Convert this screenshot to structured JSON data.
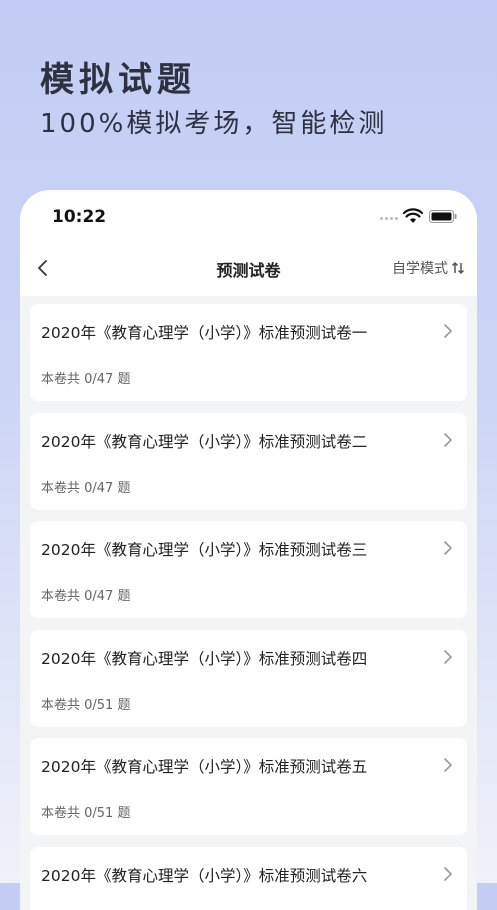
{
  "promo": {
    "title": "模拟试题",
    "subtitle": "100%模拟考场，智能检测"
  },
  "status_bar": {
    "time": "10:22"
  },
  "nav": {
    "title": "预测试卷",
    "mode_label": "自学模式"
  },
  "papers": [
    {
      "title": "2020年《教育心理学（小学）》标准预测试卷一",
      "meta": "本卷共 0/47 题"
    },
    {
      "title": "2020年《教育心理学（小学）》标准预测试卷二",
      "meta": "本卷共 0/47 题"
    },
    {
      "title": "2020年《教育心理学（小学）》标准预测试卷三",
      "meta": "本卷共 0/47 题"
    },
    {
      "title": "2020年《教育心理学（小学）》标准预测试卷四",
      "meta": "本卷共 0/51 题"
    },
    {
      "title": "2020年《教育心理学（小学）》标准预测试卷五",
      "meta": "本卷共 0/51 题"
    },
    {
      "title": "2020年《教育心理学（小学）》标准预测试卷六",
      "meta": ""
    }
  ]
}
